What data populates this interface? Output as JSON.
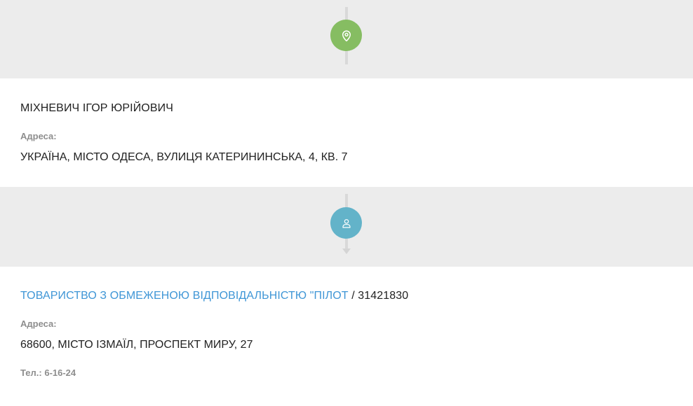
{
  "colors": {
    "green": "#86bd62",
    "blue": "#63b3c9",
    "link": "#3f96d6"
  },
  "icons": {
    "top": "map-pin-icon",
    "mid": "person-icon"
  },
  "person": {
    "name": "МІХНЕВИЧ ІГОР ЮРІЙОВИЧ",
    "address_label": "Адреса:",
    "address": "УКРАЇНА, МІСТО ОДЕСА, ВУЛИЦЯ КАТЕРИНИНСЬКА, 4, КВ. 7"
  },
  "company": {
    "name": "ТОВАРИСТВО З ОБМЕЖЕНОЮ ВІДПОВІДАЛЬНІСТЮ \"ПІЛОТ",
    "separator": " / ",
    "code": "31421830",
    "address_label": "Адреса:",
    "address": "68600, МІСТО ІЗМАЇЛ, ПРОСПЕКТ МИРУ, 27",
    "phone": "Тел.: 6-16-24"
  }
}
